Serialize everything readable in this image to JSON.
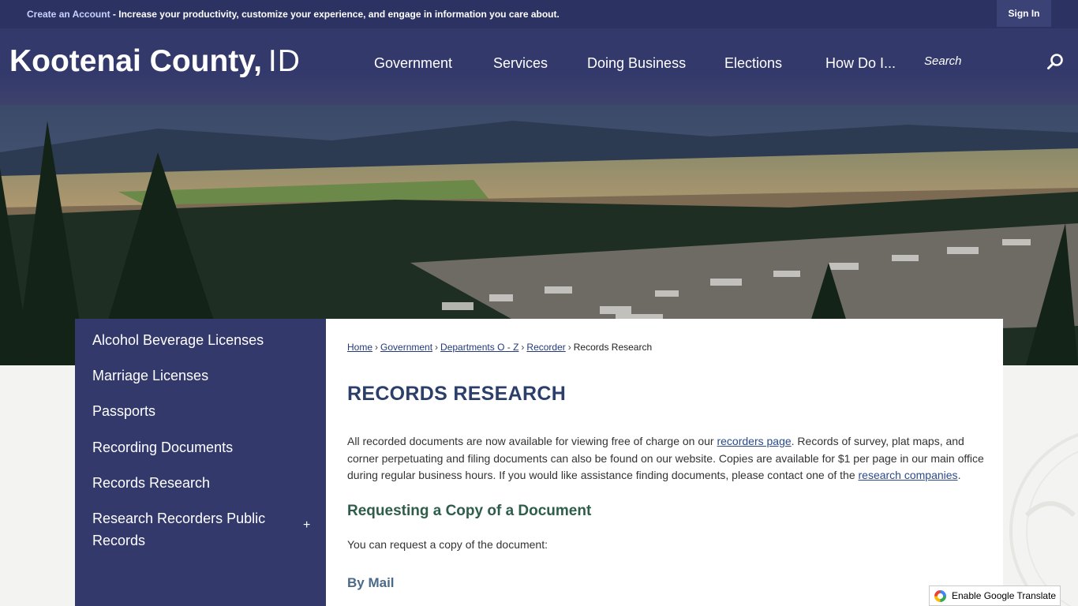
{
  "topbar": {
    "create_account_link": "Create an Account",
    "promo_text": " - Increase your productivity, customize your experience, and engage in information you care about.",
    "sign_in": "Sign In"
  },
  "header": {
    "logo_name": "Kootenai County,",
    "logo_state": "ID",
    "nav": [
      "Government",
      "Services",
      "Doing Business",
      "Elections",
      "How Do I..."
    ],
    "search_placeholder": "Search",
    "search_icon": "magnifier-icon"
  },
  "sidebar": {
    "items": [
      {
        "label": "Alcohol Beverage Licenses"
      },
      {
        "label": "Marriage Licenses"
      },
      {
        "label": "Passports"
      },
      {
        "label": "Recording Documents"
      },
      {
        "label": "Records Research"
      },
      {
        "label": "Research Recorders Public Records",
        "line1": "Research Recorders Public",
        "line2": "Records",
        "expand": "+"
      }
    ]
  },
  "breadcrumb": {
    "links": [
      "Home",
      "Government",
      "Departments O - Z",
      "Recorder"
    ],
    "current": "Records Research",
    "separator": "›"
  },
  "main": {
    "title": "RECORDS RESEARCH",
    "intro_1": "All recorded documents are now available for viewing free of charge on our ",
    "intro_link_1": "recorders page",
    "intro_2": ". Records of survey, plat maps, and corner perpetuating and filing documents can also be found on our website. Copies are available for $1 per page in our main office during regular business hours. If you would like assistance finding documents, please contact one of the ",
    "intro_link_2": "research companies",
    "intro_3": ".",
    "section_heading": "Requesting a Copy of a Document",
    "section_text": "You can request a copy of the document:",
    "subheading": "By Mail"
  },
  "translate": {
    "label": "Enable Google Translate"
  },
  "colors": {
    "nav_bg": "#333a6b",
    "topbar_bg": "#2c3362",
    "title": "#2c3f6b",
    "section_heading": "#2f5d4b"
  }
}
